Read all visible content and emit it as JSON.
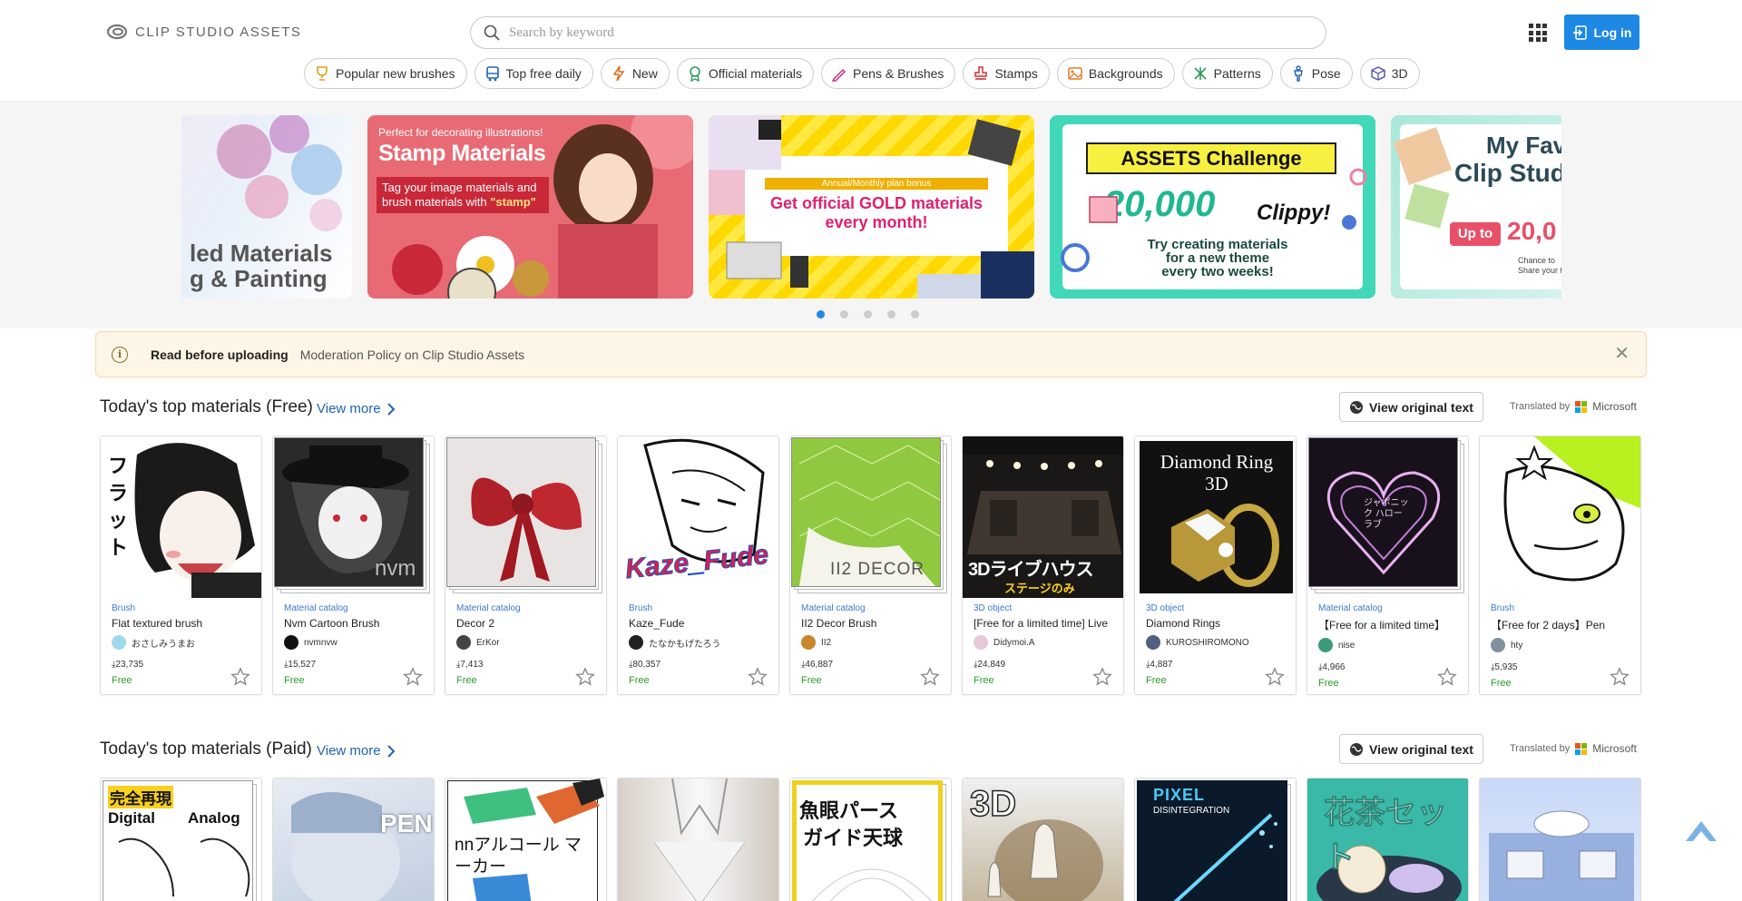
{
  "header": {
    "logo_text": "CLIP STUDIO ASSETS",
    "search_placeholder": "Search by keyword",
    "login_label": "Log in"
  },
  "categories": [
    {
      "label": "Popular new brushes",
      "icon": "trophy-icon",
      "color": "#e0a020"
    },
    {
      "label": "Top free daily",
      "icon": "bus-icon",
      "color": "#1e63b0"
    },
    {
      "label": "New",
      "icon": "lightning-icon",
      "color": "#e06a1e"
    },
    {
      "label": "Official materials",
      "icon": "award-icon",
      "color": "#2e9a5a"
    },
    {
      "label": "Pens & Brushes",
      "icon": "pen-icon",
      "color": "#c0308a"
    },
    {
      "label": "Stamps",
      "icon": "stamp-icon",
      "color": "#d03030"
    },
    {
      "label": "Backgrounds",
      "icon": "image-icon",
      "color": "#e07a1e"
    },
    {
      "label": "Patterns",
      "icon": "pattern-icon",
      "color": "#2e9a5a"
    },
    {
      "label": "Pose",
      "icon": "pose-icon",
      "color": "#1e63b0"
    },
    {
      "label": "3D",
      "icon": "cube-icon",
      "color": "#5a5ab0"
    }
  ],
  "banners": [
    {
      "line1": "led Materials",
      "line2": "g & Painting"
    },
    {
      "top": "Perfect for decorating illustrations!",
      "title": "Stamp Materials",
      "sub1": "Tag your image materials and",
      "sub2": "brush materials with ",
      "sub_em": "\"stamp\""
    },
    {
      "ribbon": "Annual/Monthly plan bonus",
      "line1": "Get official GOLD materials",
      "line2": "every month!"
    },
    {
      "title": "ASSETS Challenge",
      "amount": "20,000",
      "unit": "Clippy!",
      "sub1": "Try creating materials",
      "sub2": "for a new theme",
      "sub3": "every two weeks!"
    },
    {
      "title1": "My Fav",
      "title2": "Clip Studio P",
      "badge": "Up to",
      "amount": "20,0",
      "note1": "Chance to",
      "note2": "Share your favorite m"
    }
  ],
  "notice": {
    "bold": "Read before uploading",
    "link": "Moderation Policy on Clip Studio Assets"
  },
  "free_section": {
    "title": "Today's top materials (Free)",
    "view_more": "View more",
    "orig_button": "View original text",
    "translated_by": "Translated by",
    "translator": "Microsoft",
    "items": [
      {
        "type": "Brush",
        "name": "Flat textured brush",
        "author": "おさしみうまお",
        "downloads": "23,735",
        "price": "Free",
        "av": "#9fd8e8"
      },
      {
        "type": "Material catalog",
        "name": "Nvm Cartoon Brush",
        "author": "nvmnvw",
        "downloads": "15,527",
        "price": "Free",
        "av": "#111111"
      },
      {
        "type": "Material catalog",
        "name": "Decor 2",
        "author": "ErKor",
        "downloads": "7,413",
        "price": "Free",
        "av": "#444444"
      },
      {
        "type": "Brush",
        "name": "Kaze_Fude",
        "author": "たなかもげたろう",
        "downloads": "80,357",
        "price": "Free",
        "av": "#222222"
      },
      {
        "type": "Material catalog",
        "name": "II2 Decor Brush",
        "author": "II2",
        "downloads": "46,887",
        "price": "Free",
        "av": "#c8852a"
      },
      {
        "type": "3D object",
        "name": "[Free for a limited time] Live",
        "author": "Didymoi.A",
        "downloads": "24,849",
        "price": "Free",
        "av": "#e8c8d8"
      },
      {
        "type": "3D object",
        "name": "Diamond Rings",
        "author": "KUROSHIROMONO",
        "downloads": "4,887",
        "price": "Free",
        "av": "#506080"
      },
      {
        "type": "Material catalog",
        "name": "【Free for a limited time】",
        "author": "nise",
        "downloads": "4,966",
        "price": "Free",
        "av": "#3a9a7a"
      },
      {
        "type": "Brush",
        "name": "【Free for 2 days】Pen",
        "author": "hty",
        "downloads": "5,935",
        "price": "Free",
        "av": "#8090a0"
      }
    ]
  },
  "paid_section": {
    "title": "Today's top materials (Paid)",
    "view_more": "View more",
    "orig_button": "View original text",
    "translated_by": "Translated by",
    "translator": "Microsoft"
  },
  "thumb_texts": {
    "nvm": "nvm",
    "kaze": "Kaze_Fude",
    "decor": "II2 DECOR",
    "live1": "3Dライブハウス",
    "live2": "ステージのみ",
    "ring1": "Diamond Ring",
    "ring2": "3D",
    "heart": "ジャポニック ハローラブ",
    "paid1a": "完全再現",
    "paid1b": "Digital",
    "paid1c": "Analog",
    "paid2": "PEN",
    "paid3": "nnアルコール マーカー",
    "paid5a": "魚眼パース",
    "paid5b": "ガイド天球",
    "paid6": "3D",
    "paid7a": "PIXEL",
    "paid7b": "DISINTEGRATION",
    "paid8": "花茶セット"
  }
}
